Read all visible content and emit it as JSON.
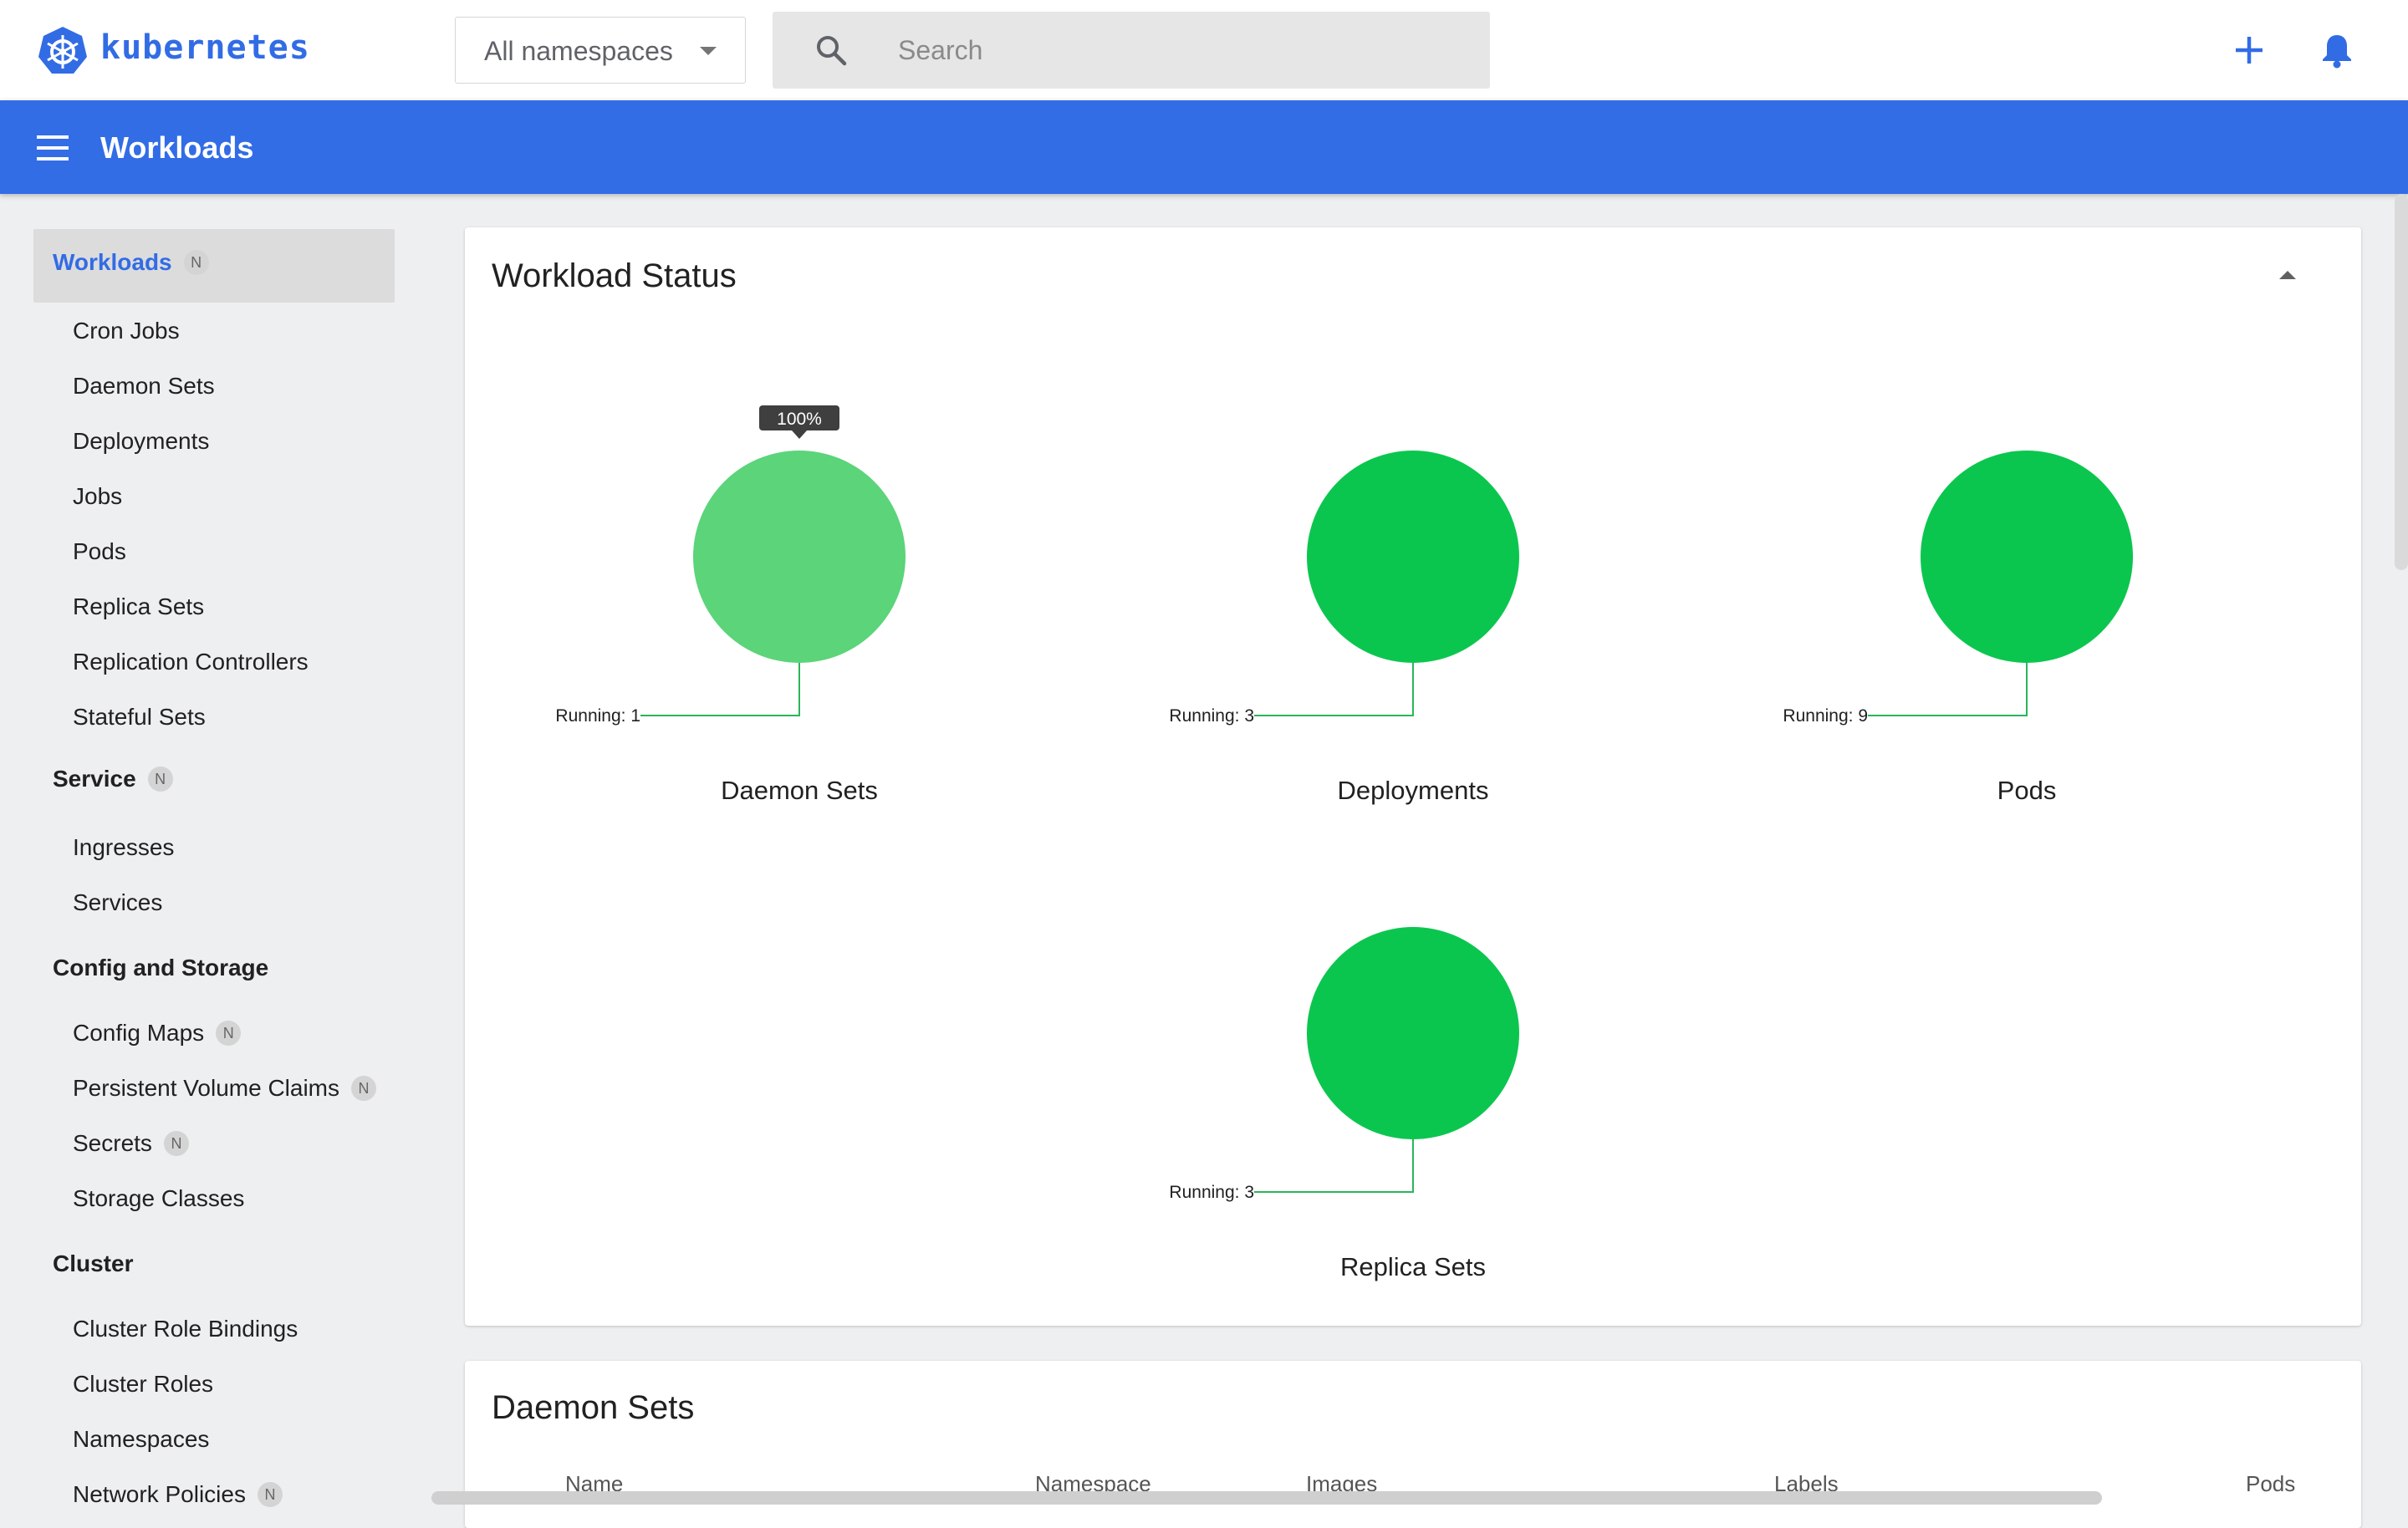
{
  "app": {
    "logo_text": "kubernetes"
  },
  "namespace_select": {
    "value": "All namespaces"
  },
  "search": {
    "placeholder": "Search"
  },
  "header": {
    "title": "Workloads"
  },
  "sidebar": {
    "badge": "N",
    "workloads": {
      "label": "Workloads",
      "items": [
        "Cron Jobs",
        "Daemon Sets",
        "Deployments",
        "Jobs",
        "Pods",
        "Replica Sets",
        "Replication Controllers",
        "Stateful Sets"
      ]
    },
    "service": {
      "label": "Service",
      "items": [
        "Ingresses",
        "Services"
      ]
    },
    "config_storage": {
      "label": "Config and Storage",
      "items": [
        "Config Maps",
        "Persistent Volume Claims",
        "Secrets",
        "Storage Classes"
      ]
    },
    "cluster": {
      "label": "Cluster",
      "items": [
        "Cluster Role Bindings",
        "Cluster Roles",
        "Namespaces",
        "Network Policies"
      ]
    }
  },
  "workload_status": {
    "title": "Workload Status"
  },
  "chart_data": {
    "type": "pie",
    "charts": [
      {
        "name": "Daemon Sets",
        "slices": [
          {
            "label": "Running",
            "value": 1,
            "percent": 100,
            "color": "#5bd47a"
          }
        ],
        "tooltip": "100%"
      },
      {
        "name": "Deployments",
        "slices": [
          {
            "label": "Running",
            "value": 3,
            "color": "#0bc64e"
          }
        ]
      },
      {
        "name": "Pods",
        "slices": [
          {
            "label": "Running",
            "value": 9,
            "color": "#0bc64e"
          }
        ]
      },
      {
        "name": "Replica Sets",
        "slices": [
          {
            "label": "Running",
            "value": 3,
            "color": "#0bc64e"
          }
        ]
      }
    ]
  },
  "daemon_sets_table": {
    "title": "Daemon Sets",
    "columns": [
      "Name",
      "Namespace",
      "Images",
      "Labels",
      "Pods"
    ]
  },
  "colors": {
    "accent": "#326ce5",
    "running": "#0bc64e"
  }
}
